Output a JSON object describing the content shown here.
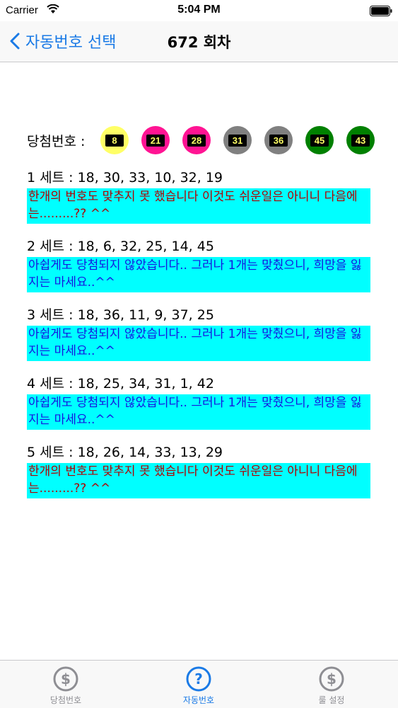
{
  "status_bar": {
    "carrier": "Carrier",
    "time": "5:04 PM"
  },
  "nav": {
    "back_label": "자동번호 선택",
    "title": "672 회차"
  },
  "winning": {
    "label": "당첨번호 :",
    "balls": [
      {
        "number": "8",
        "color": "#ffff66"
      },
      {
        "number": "21",
        "color": "#ff1493"
      },
      {
        "number": "28",
        "color": "#ff1493"
      },
      {
        "number": "31",
        "color": "#808080"
      },
      {
        "number": "36",
        "color": "#808080"
      },
      {
        "number": "45",
        "color": "#008000"
      },
      {
        "number": "43",
        "color": "#008000"
      }
    ]
  },
  "sets": [
    {
      "title": "1 세트 : 18, 30, 33, 10, 32, 19",
      "result": "한개의 번호도 맞추지 못 했습니다 이것도 쉬운일은 아니니 다음에는.........?? ^^",
      "tone": "red"
    },
    {
      "title": "2 세트 : 18, 6, 32, 25, 14, 45",
      "result": "아쉽게도 당첨되지 않았습니다.. 그러나 1개는 맞췄으니, 희망을 잃지는 마세요..^^",
      "tone": "blue"
    },
    {
      "title": "3 세트 : 18, 36, 11, 9, 37, 25",
      "result": "아쉽게도 당첨되지 않았습니다.. 그러나 1개는 맞췄으니, 희망을 잃지는 마세요..^^",
      "tone": "blue"
    },
    {
      "title": "4 세트 : 18, 25, 34, 31, 1, 42",
      "result": "아쉽게도 당첨되지 않았습니다.. 그러나 1개는 맞췄으니, 희망을 잃지는 마세요..^^",
      "tone": "blue"
    },
    {
      "title": "5 세트 : 18, 26, 14, 33, 13, 29",
      "result": "한개의 번호도 맞추지 못 했습니다 이것도 쉬운일은 아니니 다음에는.........?? ^^",
      "tone": "red"
    }
  ],
  "tabs": [
    {
      "label": "당첨번호",
      "icon": "dollar-icon",
      "active": false
    },
    {
      "label": "자동번호",
      "icon": "question-icon",
      "active": true
    },
    {
      "label": "룰 설정",
      "icon": "dollar-icon",
      "active": false
    }
  ],
  "colors": {
    "accent": "#1a7ae6",
    "highlight": "#00ffff",
    "fail_text": "#b00000",
    "near_text": "#1515e0"
  }
}
